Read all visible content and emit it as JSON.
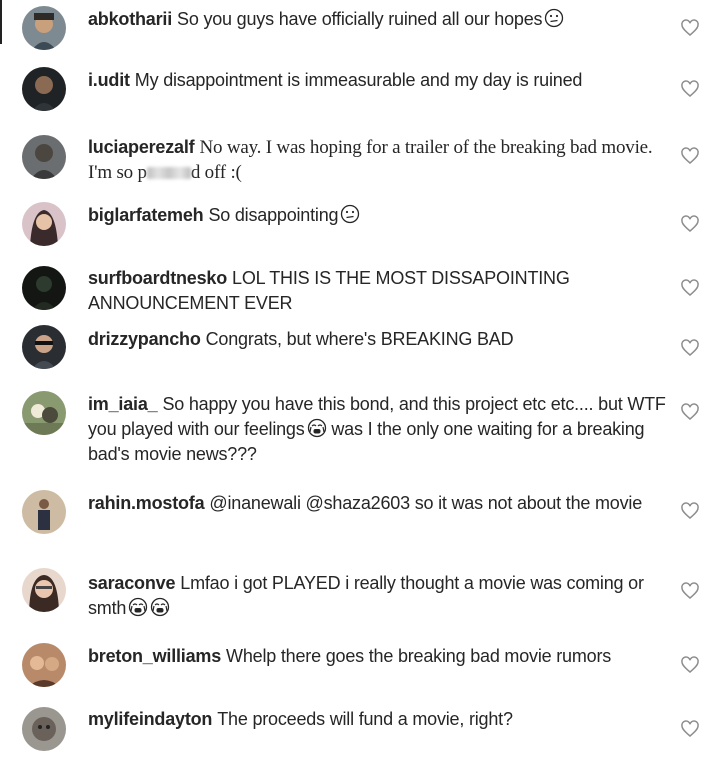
{
  "comments": [
    {
      "user": "abkotharii",
      "text": "So you guys have officially ruined all our hopes",
      "emoji": "confused-face-icon"
    },
    {
      "user": "i.udit",
      "text": "My disappointment is immeasurable and my day is ruined"
    },
    {
      "user": "luciaperezalf",
      "text": "No way. I was hoping for a trailer of the breaking bad movie. I'm so p",
      "text_after_blur": "d off :("
    },
    {
      "user": "biglarfatemeh",
      "text": "So disappointing",
      "emoji": "confused-face-icon"
    },
    {
      "user": "surfboardtnesko",
      "text": "LOL THIS IS THE MOST DISSAPOINTING ANNOUNCEMENT EVER"
    },
    {
      "user": "drizzypancho",
      "text": "Congrats, but where's BREAKING BAD"
    },
    {
      "user": "im_iaia_",
      "text": "So happy you have this bond, and this project etc etc.... but WTF you played with our feelings",
      "text_after_emoji": "was I the only one waiting for a breaking bad's movie news???",
      "emoji": "crying-face-icon"
    },
    {
      "user": "rahin.mostofa",
      "text": "@inanewali @shaza2603 so it was not about the movie"
    },
    {
      "user": "saraconve",
      "text": "Lmfao i got PLAYED i really thought a movie was coming or smth",
      "emoji": "crying-face-icon",
      "emoji_count": 2
    },
    {
      "user": "breton_williams",
      "text": "Whelp there goes the breaking bad movie rumors"
    },
    {
      "user": "mylifeindayton",
      "text": "The proceeds will fund a movie, right?"
    }
  ],
  "icons": {
    "like": "heart-outline-icon",
    "confused": "confused-face-icon",
    "crying": "crying-face-icon"
  },
  "colors": {
    "text": "#262626",
    "heart_stroke": "#8e8e8e",
    "background": "#ffffff"
  }
}
